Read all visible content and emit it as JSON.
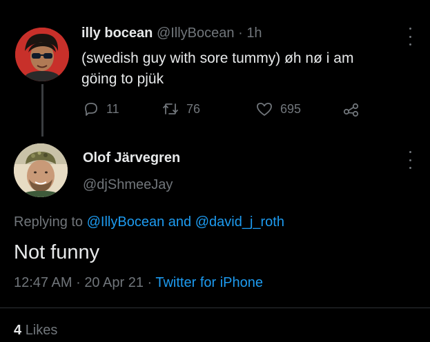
{
  "parent_tweet": {
    "display_name": "illy bocean",
    "handle": "@IllyBocean",
    "separator": "·",
    "time": "1h",
    "text_line1": "(swedish guy with sore tummy) øh nø i am",
    "text_line2": "göing to pjük",
    "reply_count": "11",
    "retweet_count": "76",
    "like_count": "695"
  },
  "reply_tweet": {
    "display_name": "Olof Järvegren",
    "handle": "@djShmeeJay",
    "replying_prefix": "Replying to",
    "replying_user1": "@IllyBocean",
    "replying_and": "and",
    "replying_user2": "@david_j_roth",
    "text": "Not funny",
    "time": "12:47 AM",
    "date": "20 Apr 21",
    "separator": "·",
    "client": "Twitter for iPhone",
    "likes_count": "4",
    "likes_label": "Likes"
  },
  "icons": {
    "reply": "reply-icon",
    "retweet": "retweet-icon",
    "like": "heart-icon",
    "share": "share-icon",
    "more": "more-icon"
  },
  "colors": {
    "background": "#000000",
    "text": "#e7e9ea",
    "muted": "#71767b",
    "link": "#1d9bf0"
  }
}
